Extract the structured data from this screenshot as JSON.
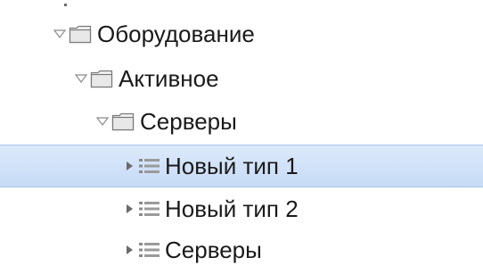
{
  "tree": {
    "items": [
      {
        "label": "Оборудование",
        "type": "folder",
        "expanded": true,
        "selected": false
      },
      {
        "label": "Активное",
        "type": "folder",
        "expanded": true,
        "selected": false
      },
      {
        "label": "Серверы",
        "type": "folder",
        "expanded": true,
        "selected": false
      },
      {
        "label": "Новый тип 1",
        "type": "list",
        "expanded": false,
        "selected": true
      },
      {
        "label": "Новый тип 2",
        "type": "list",
        "expanded": false,
        "selected": false
      },
      {
        "label": "Серверы",
        "type": "list",
        "expanded": false,
        "selected": false
      }
    ]
  },
  "colors": {
    "selection": "#cfe0f8",
    "selection_border": "#a9c3ea",
    "text": "#1a1a1a",
    "icon_stroke": "#7a7a7a"
  }
}
